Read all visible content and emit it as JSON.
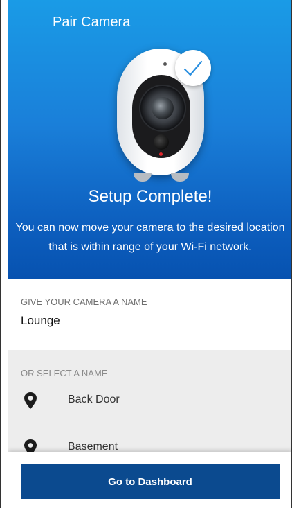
{
  "header": {
    "title": "Pair Camera"
  },
  "hero": {
    "status_title": "Setup Complete!",
    "description": "You can now move your camera to the desired location that is within range of your Wi-Fi network."
  },
  "name_field": {
    "label": "GIVE YOUR CAMERA A NAME",
    "value": "Lounge"
  },
  "select_name": {
    "label": "OR SELECT A NAME",
    "items": [
      {
        "label": "Back Door",
        "icon": "map-pin-icon"
      },
      {
        "label": "Basement",
        "icon": "map-pin-icon"
      }
    ]
  },
  "footer": {
    "button_label": "Go to Dashboard"
  },
  "colors": {
    "hero_top": "#1a9be6",
    "hero_bottom": "#0752b0",
    "button": "#0b4a8f",
    "list_background": "#ededed"
  }
}
